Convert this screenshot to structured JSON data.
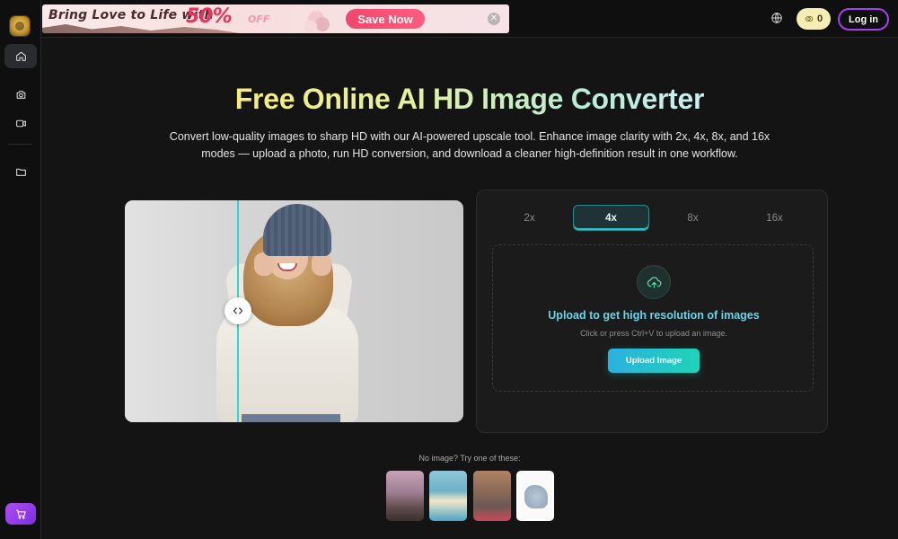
{
  "promo": {
    "headline": "Bring Love to Life with",
    "percent": "50%",
    "off": "OFF",
    "cta": "Save Now",
    "close": "✕"
  },
  "header": {
    "credits": "0",
    "login": "Log in"
  },
  "hero": {
    "title": "Free Online AI HD Image Converter",
    "subtitle": "Convert low-quality images to sharp HD with our AI-powered upscale tool. Enhance image clarity with 2x, 4x, 8x, and 16x modes — upload a photo, run HD conversion, and download a cleaner high-definition result in one workflow."
  },
  "upscale": {
    "tabs": [
      {
        "label": "2x",
        "active": false
      },
      {
        "label": "4x",
        "active": true
      },
      {
        "label": "8x",
        "active": false
      },
      {
        "label": "16x",
        "active": false
      }
    ],
    "upload_title": "Upload to get high resolution of images",
    "upload_hint": "Click or press Ctrl+V to upload an image.",
    "upload_button": "Upload Image"
  },
  "samples": {
    "label": "No image? Try one of these:"
  },
  "colors": {
    "accent_teal": "#2fd6d6",
    "login_border": "#a63df0",
    "promo_pink": "#f0466b"
  }
}
